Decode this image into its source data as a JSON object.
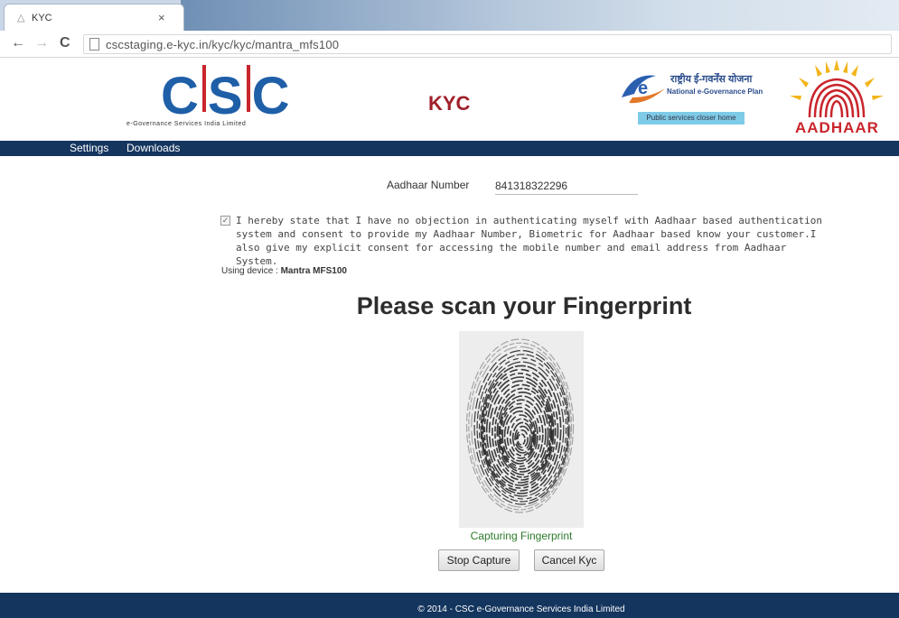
{
  "browser": {
    "tab_title": "KYC",
    "tab_close": "×",
    "back_icon": "←",
    "forward_icon": "→",
    "reload_icon": "C",
    "url": "cscstaging.e-kyc.in/kyc/kyc/mantra_mfs100"
  },
  "header": {
    "csc_logo_text": "CSC",
    "csc_logo_subtitle": "e-Governance Services India Limited",
    "kyc_title": "KYC",
    "egov_hindi": "राष्ट्रीय ई-गवर्नेंस योजना",
    "egov_name": "National e-Governance Plan",
    "egov_slogan": "Public services closer home",
    "aadhaar_wordmark": "AADHAAR"
  },
  "nav": {
    "items": [
      {
        "label": "Settings"
      },
      {
        "label": "Downloads"
      }
    ]
  },
  "form": {
    "aadhaar_label": "Aadhaar Number",
    "aadhaar_value": "841318322296",
    "consent_checked": true,
    "consent_text": "I hereby state that I have no objection in authenticating myself with Aadhaar based authentication system and consent to provide my Aadhaar Number, Biometric for Aadhaar based know your customer.I also give my explicit consent for accessing the mobile number and email address from Aadhaar System.",
    "device_prefix": "Using device : ",
    "device_name": "Mantra MFS100"
  },
  "scan": {
    "title": "Please scan your Fingerprint",
    "status": "Capturing Fingerprint",
    "stop_label": "Stop Capture",
    "cancel_label": "Cancel Kyc"
  },
  "footer": {
    "text": "© 2014 - CSC e-Governance Services India Limited"
  },
  "colors": {
    "navy": "#14355e",
    "kyc_red": "#a0202a",
    "status_green": "#2c7a2c",
    "csc_blue": "#1f5fa8"
  }
}
